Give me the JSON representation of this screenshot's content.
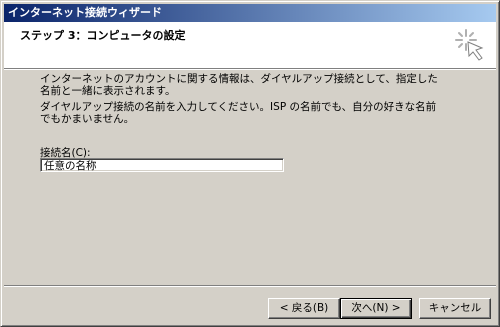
{
  "window": {
    "title": "インターネット接続ウィザード"
  },
  "header": {
    "step_title": "ステップ 3：コンピュータの設定",
    "icon": "wizard-sparkle-icon"
  },
  "main": {
    "paragraph1": "インターネットのアカウントに関する情報は、ダイヤルアップ接続として、指定した名前と一緒に表示されます。",
    "paragraph2": "ダイヤルアップ接続の名前を入力してください。ISP の名前でも、自分の好きな名前でもかまいません。",
    "field_label": "接続名(C):",
    "field_value": "任意の名称"
  },
  "buttons": {
    "back": "< 戻る(B)",
    "next": "次へ(N) >",
    "cancel": "キャンセル"
  },
  "colors": {
    "title_gradient_start": "#0a246a",
    "title_gradient_end": "#a6caf0",
    "face": "#d4d0c8"
  }
}
